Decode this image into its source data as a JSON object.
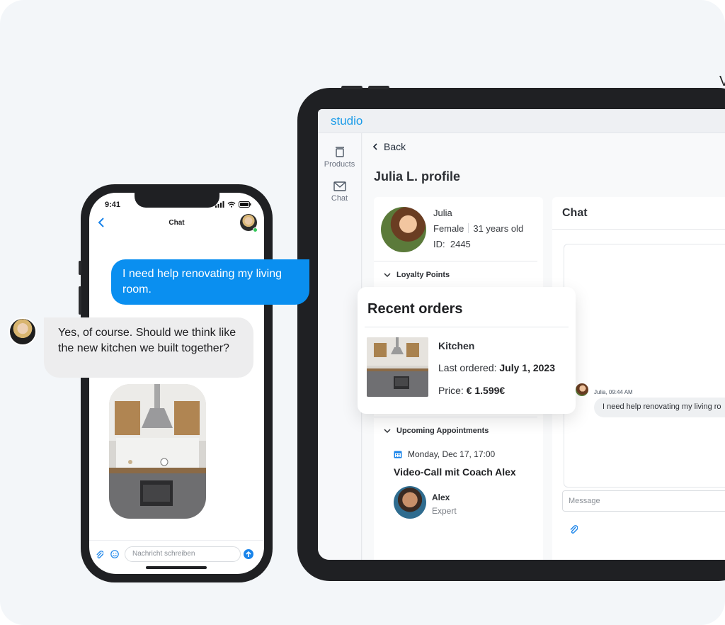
{
  "tablet": {
    "brand": "studio",
    "sidebar": [
      {
        "label": "Products",
        "icon": "trash-bin-icon"
      },
      {
        "label": "Chat",
        "icon": "mail-icon"
      }
    ],
    "back_label": "Back",
    "page_title": "Julia L. profile",
    "profile": {
      "name": "Julia",
      "gender": "Female",
      "age": "31 years old",
      "id_label": "ID:",
      "id_value": "2445"
    },
    "sections": {
      "loyalty": "Loyalty Points",
      "appointments": "Upcoming Appointments"
    },
    "appointment": {
      "date": "Monday, Dec 17, 17:00",
      "title": "Video-Call mit Coach Alex",
      "coach_name": "Alex",
      "coach_role": "Expert"
    },
    "chat": {
      "title": "Chat",
      "meta": "Julia, 09:44 AM",
      "message": "I need help renovating my living ro",
      "input_placeholder": "Message"
    }
  },
  "orders": {
    "title": "Recent orders",
    "item_name": "Kitchen",
    "last_ordered_label": "Last ordered:",
    "last_ordered_value": "July 1, 2023",
    "price_label": "Price:",
    "price_value": "€ 1.599€"
  },
  "phone": {
    "time": "9:41",
    "nav_title": "Chat",
    "input_placeholder": "Nachricht schreiben"
  },
  "bubbles": {
    "outgoing": "I need help renovating my living room.",
    "incoming": "Yes, of course. Should we think like the new kitchen we built together?"
  },
  "edge_glyph": "V",
  "colors": {
    "accent": "#0a8ff0",
    "brand": "#1a9be8",
    "online": "#34c759"
  }
}
